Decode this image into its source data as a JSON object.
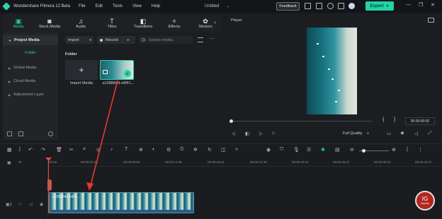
{
  "titlebar": {
    "app_name": "Wondershare Filmora 12 Beta",
    "menu": [
      "File",
      "Edit",
      "Tools",
      "View",
      "Help"
    ],
    "document": "Untitled",
    "feedback_label": "Feedback",
    "export_label": "Export"
  },
  "tool_tabs": [
    {
      "label": "Media",
      "icon": "media-icon",
      "glyph": "▣"
    },
    {
      "label": "Stock Media",
      "icon": "stock-media-icon",
      "glyph": "◙"
    },
    {
      "label": "Audio",
      "icon": "audio-icon",
      "glyph": "♫"
    },
    {
      "label": "Titles",
      "icon": "titles-icon",
      "glyph": "T"
    },
    {
      "label": "Transitions",
      "icon": "transitions-icon",
      "glyph": "◧"
    },
    {
      "label": "Effects",
      "icon": "effects-icon",
      "glyph": "✧"
    },
    {
      "label": "Stickers",
      "icon": "stickers-icon",
      "glyph": "✿"
    }
  ],
  "sidebar": {
    "project_media": "Project Media",
    "folder": "Folder",
    "items": [
      "Global Media",
      "Cloud Media",
      "Adjustment Layer"
    ]
  },
  "media_toolbar": {
    "import_label": "Import",
    "record_label": "Record",
    "search_placeholder": "Search media"
  },
  "media": {
    "folder_label": "Folder",
    "import_tile_label": "Import Media",
    "clip_label": "a108884d-e8f41..."
  },
  "player": {
    "title": "Player",
    "timecode": "00:00:00:00",
    "quality": "Full Quality",
    "bracket_in": "{",
    "bracket_out": "}"
  },
  "ruler": {
    "labels": [
      "00:00",
      "00:00:04:25",
      "00:00:09:50",
      "00:00:14:45",
      "00:00:19:41",
      "00:00:24:36",
      "00:00:29:31",
      "00:00:34:27",
      "00:00:39:22",
      "00:00:44:17"
    ]
  },
  "timeline": {
    "clip_name": "a108884d-e8f4..."
  },
  "badge": {
    "initials": "IG",
    "sub": "Imports"
  },
  "colors": {
    "accent": "#22d3a5",
    "playhead": "#e84a3c",
    "annotation_arrow": "#e8382c"
  }
}
